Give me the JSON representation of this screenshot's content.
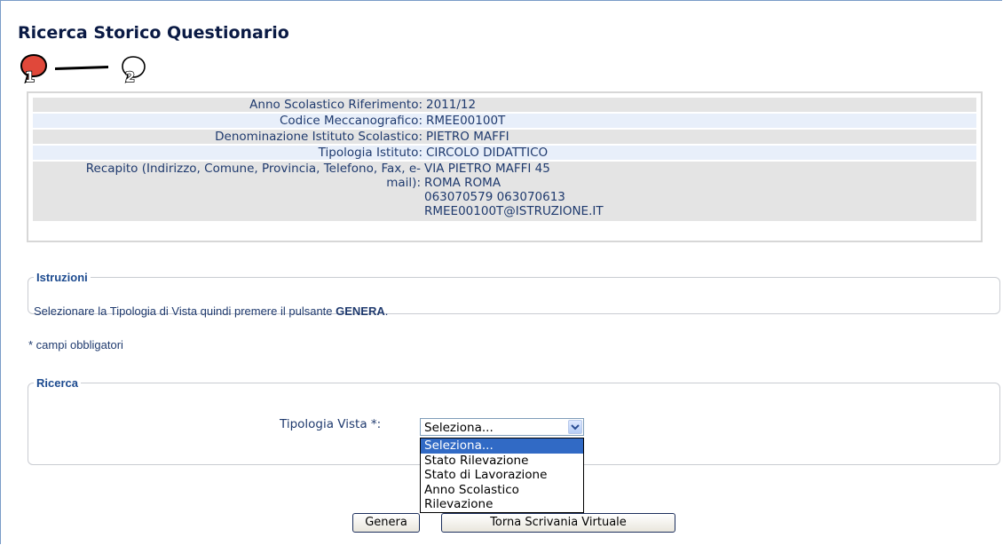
{
  "page": {
    "title": "Ricerca Storico Questionario"
  },
  "steps": {
    "step1": "1",
    "step2": "2",
    "current_step": 1
  },
  "info": {
    "rows": [
      {
        "label": "Anno Scolastico Riferimento:",
        "value": "2011/12"
      },
      {
        "label": "Codice Meccanografico:",
        "value": "RMEE00100T"
      },
      {
        "label": "Denominazione Istituto Scolastico:",
        "value": "PIETRO MAFFI"
      },
      {
        "label": "Tipologia Istituto:",
        "value": "CIRCOLO DIDATTICO"
      },
      {
        "label": "Recapito (Indirizzo, Comune, Provincia, Telefono, Fax, e-mail):",
        "value": "VIA PIETRO MAFFI 45\nROMA ROMA\n063070579 063070613\nRMEE00100T@ISTRUZIONE.IT"
      }
    ]
  },
  "istruzioni": {
    "legend": "Istruzioni",
    "text_before": "Selezionare la Tipologia di Vista quindi premere il pulsante ",
    "text_bold": "GENERA",
    "text_after": "."
  },
  "required_note": "* campi obbligatori",
  "ricerca": {
    "legend": "Ricerca",
    "select_label": "Tipologia Vista *:",
    "select_value": "Seleziona...",
    "options": [
      "Seleziona...",
      "Stato Rilevazione",
      "Stato di Lavorazione",
      "Anno Scolastico",
      "Rilevazione"
    ]
  },
  "buttons": {
    "genera": "Genera",
    "torna": "Torna Scrivania Virtuale"
  },
  "colors": {
    "text": "#1f3a6e",
    "legend": "#1c4a8f",
    "row_gray": "#e4e4e4",
    "row_blue": "#e8effa",
    "highlight": "#316ac5",
    "step_active": "#e0483a"
  }
}
